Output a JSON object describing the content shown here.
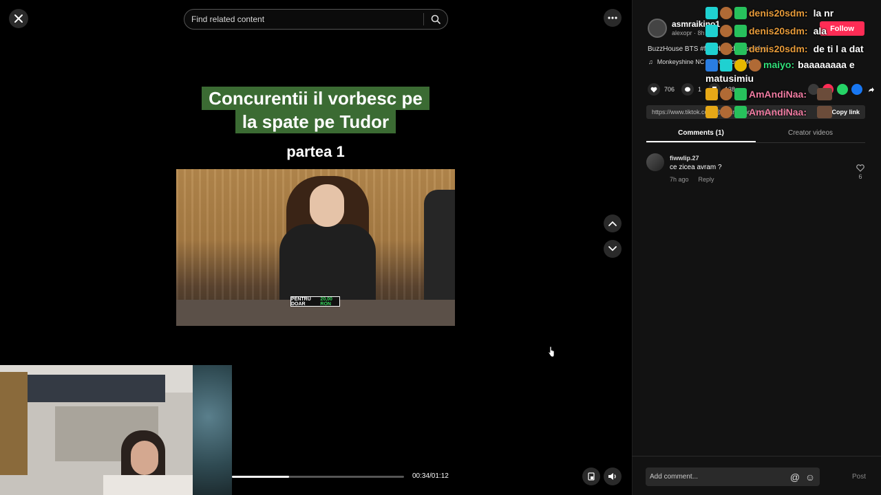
{
  "search": {
    "placeholder": "Find related content"
  },
  "video": {
    "caption_line1": "Concurentii il vorbesc pe",
    "caption_line2": "la spate pe Tudor",
    "part_label": "partea 1",
    "badge_prefix": "PENTRU DOAR",
    "badge_price": "20,00 RON",
    "progress": 0.33,
    "time": "00:34/01:12"
  },
  "author": {
    "name": "asmraikino1",
    "sub": "alexopr · 8h ago",
    "follow_label": "Follow"
  },
  "description": "BuzzHouse BTS #fyp #buzzhouse #fyp",
  "music": "Monkeyshine NC - Fit Gibbons Mer...",
  "stats": {
    "likes": "706",
    "comments": "1",
    "saves": "138"
  },
  "share": {
    "url": "https://www.tiktok.com/@asmraikino1/video/7453...",
    "copy_label": "Copy link"
  },
  "tabs": [
    {
      "label": "Comments (1)",
      "active": true
    },
    {
      "label": "Creator videos",
      "active": false
    }
  ],
  "comments": [
    {
      "user": "fiwwlip.27",
      "text": "ce zicea avram ?",
      "time": "7h ago",
      "reply": "Reply",
      "likes": "6"
    }
  ],
  "composer": {
    "placeholder": "Add comment...",
    "post_label": "Post"
  },
  "chat": [
    {
      "user": "denis20sdm:",
      "message": "la nr",
      "color_class": "chat-user-1"
    },
    {
      "user": "denis20sdm:",
      "message": "ala",
      "color_class": "chat-user-1"
    },
    {
      "user": "denis20sdm:",
      "message": "de ti l a dat",
      "color_class": "chat-user-1"
    },
    {
      "user": "maiyo:",
      "message": "baaaaaaaa e matusimiu",
      "color_class": "chat-user-2"
    },
    {
      "user": "AmAndiNaa:",
      "message": "",
      "color_class": "chat-user-3"
    },
    {
      "user": "AmAndiNaa:",
      "message": "",
      "color_class": "chat-user-3"
    }
  ],
  "colors": {
    "follow": "#fe2c55",
    "caption_bg": "#3b6b33",
    "badge_price": "#36d35a"
  }
}
